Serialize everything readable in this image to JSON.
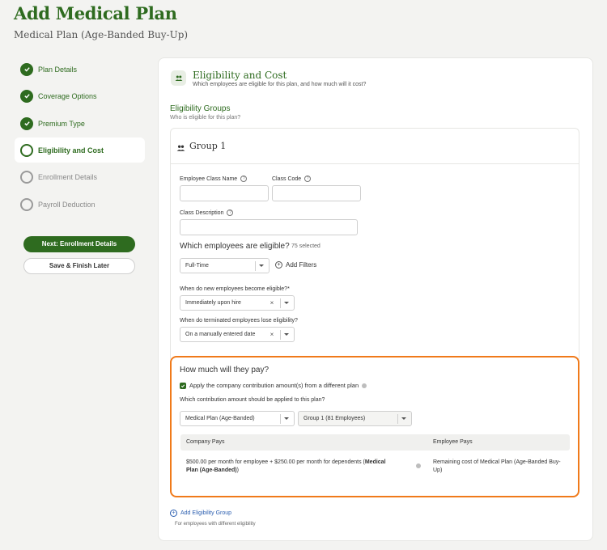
{
  "page": {
    "title": "Add Medical Plan",
    "subtitle": "Medical Plan (Age-Banded Buy-Up)"
  },
  "steps": [
    {
      "label": "Plan Details",
      "state": "done"
    },
    {
      "label": "Coverage Options",
      "state": "done"
    },
    {
      "label": "Premium Type",
      "state": "done"
    },
    {
      "label": "Eligibility and Cost",
      "state": "current"
    },
    {
      "label": "Enrollment Details",
      "state": "todo"
    },
    {
      "label": "Payroll Deduction",
      "state": "todo"
    }
  ],
  "actions": {
    "next_label": "Next: Enrollment Details",
    "save_label": "Save & Finish Later"
  },
  "section": {
    "title": "Eligibility and Cost",
    "subtitle": "Which employees are eligible for this plan, and how much will it cost?",
    "groups_title": "Eligibility Groups",
    "groups_subtitle": "Who is eligible for this plan?"
  },
  "group": {
    "title": "Group 1",
    "class_name_label": "Employee Class Name",
    "class_code_label": "Class Code",
    "class_desc_label": "Class Description",
    "class_name_value": "",
    "class_code_value": "",
    "class_desc_value": "",
    "eligible_heading": "Which employees are eligible?",
    "eligible_count": "75 selected",
    "employment_type": "Full-Time",
    "add_filters": "Add Filters",
    "new_eligible_label": "When do new employees become eligible?*",
    "new_eligible_value": "Immediately upon hire",
    "terminated_label": "When do terminated employees lose eligibility?",
    "terminated_value": "On a manually entered date"
  },
  "pay": {
    "heading": "How much will they pay?",
    "apply_checkbox_label": "Apply the company contribution amount(s) from a different plan",
    "apply_checked": true,
    "which_label": "Which contribution amount should be applied to this plan?",
    "plan_select": "Medical Plan (Age-Banded)",
    "group_select": "Group 1 (81 Employees)",
    "table": {
      "col_company": "Company Pays",
      "col_employee": "Employee Pays",
      "company_text": "$500.00 per month for employee + $250.00 per month for dependents (",
      "company_bold": "Medical Plan (Age-Banded)",
      "company_close": ")",
      "employee_text": "Remaining cost of Medical Plan (Age-Banded Buy-Up)"
    }
  },
  "add_group": {
    "label": "Add Eligibility Group",
    "sub": "For employees with different eligibility"
  },
  "colors": {
    "brand_green": "#2e6b1f",
    "highlight_orange": "#f07a1a",
    "link_blue": "#2c5fb0"
  }
}
